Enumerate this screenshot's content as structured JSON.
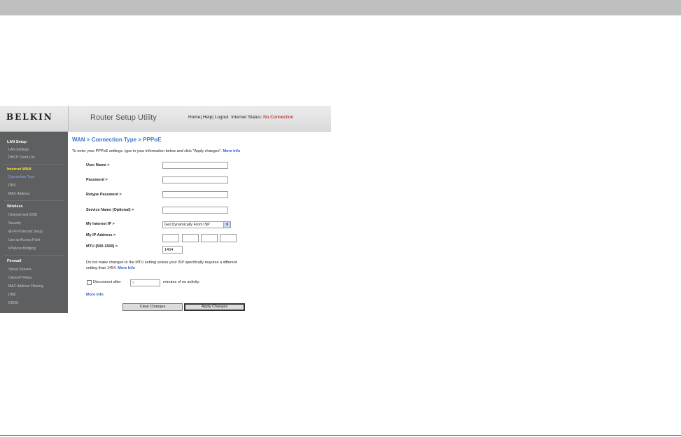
{
  "header": {
    "logo": "BELKIN",
    "title": "Router Setup Utility",
    "home": "Home",
    "help": "Help",
    "logout": "Logout",
    "status_label": "Internet Status:",
    "status_value": "No Connection",
    "status_color": "#b00000"
  },
  "sidebar": {
    "sections": [
      {
        "title": "LAN Setup",
        "items": [
          "LAN Settings",
          "DHCP Client List"
        ]
      },
      {
        "title": "Internet WAN",
        "items": [
          "Connection Type",
          "DNS",
          "MAC Address"
        ]
      },
      {
        "title": "Wireless",
        "items": [
          "Channel and SSID",
          "Security",
          "Wi-Fi Protected Setup",
          "Use as Access Point",
          "Wireless Bridging"
        ]
      },
      {
        "title": "Firewall",
        "items": [
          "Virtual Servers",
          "Client IP Filters",
          "MAC Address Filtering",
          "DMZ",
          "DDNS"
        ]
      }
    ],
    "active_section_color": "#ffe033",
    "active_item_color": "#8fa6ff"
  },
  "main": {
    "title": "WAN > Connection Type > PPPoE",
    "intro": "To enter your PPPoE settings, type in your information below and click \"Apply changes\".",
    "more_info": "More info",
    "fields": {
      "user_name": {
        "label": "User Name >",
        "value": ""
      },
      "password": {
        "label": "Password >",
        "value": ""
      },
      "retype_password": {
        "label": "Retype Password >",
        "value": ""
      },
      "service_name": {
        "label": "Service Name (Optional) >",
        "value": ""
      },
      "internet_ip": {
        "label": "My Internet IP >",
        "value": "Get Dynamically From ISP"
      },
      "ip_address": {
        "label": "My IP Address >",
        "octets": [
          "",
          "",
          "",
          ""
        ]
      },
      "mtu": {
        "label": "MTU (500-1500) >",
        "value": "1454"
      }
    },
    "note_line1": "Do not make changes to the MTU setting unless your ISP specifically requires a different",
    "note_line2": "setting than 1454.",
    "note_more": "More Info",
    "disconnect_label": "Disconnect after",
    "disconnect_value": "5",
    "disconnect_suffix": "minutes of no activity.",
    "more_info2": "More Info",
    "clear_button": "Clear Changes",
    "apply_button": "Apply Changes",
    "accent_color": "#3a78c9"
  }
}
